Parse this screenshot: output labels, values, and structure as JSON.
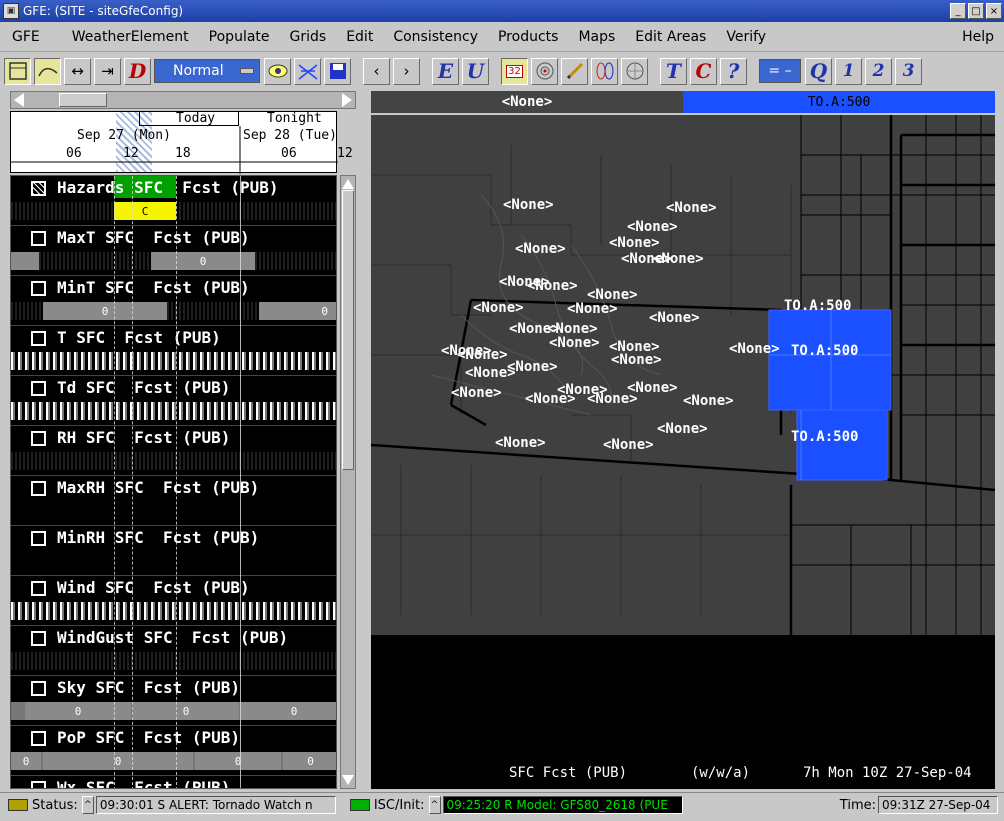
{
  "window": {
    "title": "GFE: (SITE - siteGfeConfig)",
    "controls": [
      "_",
      "□",
      "×"
    ]
  },
  "menu": [
    "GFE",
    "WeatherElement",
    "Populate",
    "Grids",
    "Edit",
    "Consistency",
    "Products",
    "Maps",
    "Edit Areas",
    "Verify",
    "Help"
  ],
  "toolbar": {
    "mode": "Normal",
    "time_step": "32",
    "letters_a": [
      "D",
      "E",
      "U",
      "T",
      "C",
      "?",
      "Q",
      "1",
      "2",
      "3"
    ],
    "equals": "="
  },
  "timescale": {
    "today": "Today",
    "tonight": "Tonight",
    "day1": "Sep 27 (Mon)",
    "day2": "Sep 28 (Tue)",
    "hours": [
      "06",
      "12",
      "18",
      "06",
      "12"
    ]
  },
  "grids": [
    {
      "name": "Hazards SFC  Fcst (PUB)",
      "value": "C",
      "checked": true
    },
    {
      "name": "MaxT SFC  Fcst (PUB)",
      "value": "0"
    },
    {
      "name": "MinT SFC  Fcst (PUB)",
      "value": "0"
    },
    {
      "name": "T SFC  Fcst (PUB)"
    },
    {
      "name": "Td SFC  Fcst (PUB)"
    },
    {
      "name": "RH SFC  Fcst (PUB)"
    },
    {
      "name": "MaxRH SFC  Fcst (PUB)"
    },
    {
      "name": "MinRH SFC  Fcst (PUB)"
    },
    {
      "name": "Wind SFC  Fcst (PUB)"
    },
    {
      "name": "WindGust SFC  Fcst (PUB)"
    },
    {
      "name": "Sky SFC  Fcst (PUB)",
      "values": [
        "0",
        "0",
        "0"
      ]
    },
    {
      "name": "PoP SFC  Fcst (PUB)",
      "values": [
        "0",
        "0",
        "0",
        "0"
      ]
    },
    {
      "name": "Wx SFC  Fcst (PUB)"
    }
  ],
  "map": {
    "header_none": "<None>",
    "header_toa": "TO.A:500",
    "none_label": "<None>",
    "toa_label": "TO.A:500",
    "colors": {
      "hazard": "#1a50ff",
      "land": "#404040"
    },
    "footer": {
      "element": "SFC Fcst (PUB)",
      "units": "(w/w/a)",
      "time": "7h Mon 10Z 27-Sep-04"
    }
  },
  "statusbar": {
    "status_label": "Status:",
    "status_text": "09:30:01 S ALERT: Tornado Watch n",
    "isc_label": "ISC/Init:",
    "isc_text": "09:25:20 R Model: GFS80_2618 (PUE",
    "time_label": "Time:",
    "time_text": "09:31Z 27-Sep-04"
  }
}
